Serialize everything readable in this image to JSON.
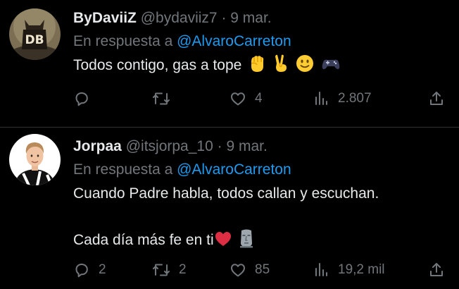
{
  "tweets": [
    {
      "name": "ByDaviiZ",
      "handle": "@bydaviiz7",
      "separator": "·",
      "date": "9 mar.",
      "reply_prefix": "En respuesta a",
      "reply_to": "@AlvaroCarreton",
      "text_lines": [
        "Todos contigo, gas a tope"
      ],
      "emojis": [
        "raised-fist",
        "victory-hand",
        "slightly-smiling-face",
        "video-game"
      ],
      "stats": {
        "replies": "",
        "retweets": "",
        "likes": "4",
        "views": "2.807"
      }
    },
    {
      "name": "Jorpaa",
      "handle": "@itsjorpa_10",
      "separator": "·",
      "date": "9 mar.",
      "reply_prefix": "En respuesta a",
      "reply_to": "@AlvaroCarreton",
      "text_lines": [
        "Cuando Padre habla, todos callan y escuchan.",
        "Cada día más fe en ti"
      ],
      "emojis": [
        "red-heart",
        "moai"
      ],
      "stats": {
        "replies": "2",
        "retweets": "2",
        "likes": "85",
        "views": "19,2 mil"
      }
    }
  ],
  "colors": {
    "background": "#000000",
    "text": "#e7e9ea",
    "muted": "#71767b",
    "link": "#1d9bf0",
    "divider": "#2f3336"
  }
}
